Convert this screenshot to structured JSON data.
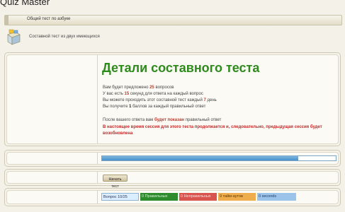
{
  "app": {
    "title": "Quiz Master"
  },
  "breadcrumb": {
    "label": "Общий тест по азбуке"
  },
  "header_info": {
    "description": "Составной тест из двух имеющихся",
    "icon": "box-icon"
  },
  "details": {
    "heading": "Детали составного теста",
    "lines": {
      "questions": {
        "before": "Вам будет предложено",
        "value": "25",
        "after": "вопросов"
      },
      "seconds": {
        "before": "У вас есть",
        "value": "15",
        "after": "секунд для ответа на каждый вопрос"
      },
      "days": {
        "before": "Вы можете проходить этот составной тест каждый",
        "value": "7",
        "after": "день"
      },
      "points": {
        "before": "Вы получите",
        "value": "1",
        "after": "баллов за каждый правильный ответ"
      }
    },
    "after_answer": {
      "before": "После вашего ответа вам",
      "highlight": "будет показан",
      "after": "правильный ответ"
    },
    "warning": "В настоящее время сессия для этого теста продолжается и, следовательно, предыдущая сессия будет возобновлена"
  },
  "progress": {
    "fraction": 0.84
  },
  "start_button": {
    "label": "Начать тест"
  },
  "stats": {
    "question": "Вопрос 10/25",
    "correct": "0 Правильных",
    "incorrect": "0 Неправильных",
    "timeouts": "9 тайм-аутов",
    "seconds": "0 seconds"
  },
  "colors": {
    "heading": "#2f8a1e",
    "warning": "#c62828",
    "stat_question_bg": "#dbeeff",
    "stat_correct_bg": "#2e8b2e",
    "stat_incorrect_bg": "#d9534f",
    "stat_timeouts_bg": "#f0ad4e",
    "stat_seconds_bg": "#9cc3ea"
  }
}
